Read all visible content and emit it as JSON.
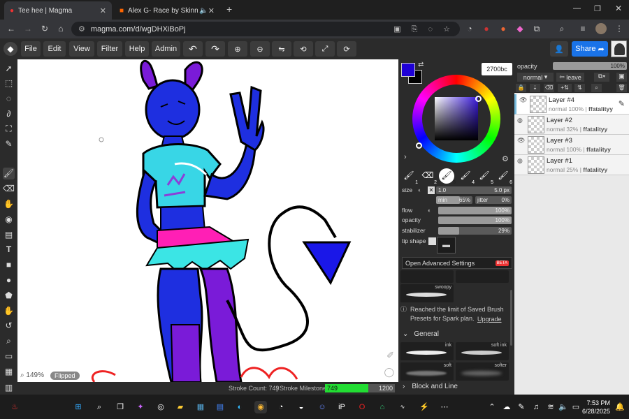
{
  "browser": {
    "tabs": [
      {
        "title": "Tee hee | Magma",
        "active": true
      },
      {
        "title": "Alex G- Race by SkinnyNSt",
        "active": false
      }
    ],
    "url": "magma.com/d/wgDHXiBoPj"
  },
  "menu": {
    "items": [
      "File",
      "Edit",
      "View",
      "Filter",
      "Help",
      "Admin"
    ],
    "share_label": "Share"
  },
  "canvas": {
    "zoom": "149%",
    "flipped_label": "Flipped"
  },
  "status": {
    "stroke_count": "Stroke Count: 749",
    "milestone_label": "Stroke Milestone:",
    "milestone_value": "749",
    "milestone_max": "1200",
    "milestone_progress": 0.62
  },
  "colors": {
    "primary": "#1e00d6",
    "secondary": "#000000",
    "hex_value": "2700bc",
    "accent_blue": "#1a73e8"
  },
  "brush": {
    "size_label": "size",
    "size_value": "1.0",
    "size_px": "5.0 px",
    "min_label": "min",
    "min_value": "65%",
    "jitter_label": "jitter",
    "jitter_value": "0%",
    "flow_label": "flow",
    "flow_value": "100%",
    "opacity_label": "opacity",
    "opacity_value": "100%",
    "stabilizer_label": "stabilizer",
    "stabilizer_value": "29%",
    "stabilizer_fill": 0.29,
    "tip_label": "tip shape",
    "advanced_label": "Open Advanced Settings",
    "beta_label": "BETA",
    "presets": [
      "1",
      "2",
      "3",
      "4",
      "5",
      "6"
    ],
    "limit_text": "Reached the limit of Saved Brush Presets for Spark plan.",
    "upgrade_label": "Upgrade",
    "general_label": "General",
    "brush_names": [
      "swoopy",
      "ink",
      "soft ink",
      "soft",
      "softer"
    ],
    "block_label": "Block and Line"
  },
  "layers_panel": {
    "opacity_label": "opacity",
    "opacity_value": "100%",
    "blend_mode": "normal",
    "leave_label": "leave",
    "layers": [
      {
        "name": "Layer #4",
        "meta": "normal 100%",
        "owner": "ffatalityy",
        "selected": true
      },
      {
        "name": "Layer #2",
        "meta": "normal 32%",
        "owner": "ffatalityy",
        "selected": false
      },
      {
        "name": "Layer #3",
        "meta": "normal 100%",
        "owner": "ffatalityy",
        "selected": false
      },
      {
        "name": "Layer #1",
        "meta": "normal 25%",
        "owner": "ffatalityy",
        "selected": false
      }
    ]
  },
  "taskbar": {
    "time": "7:53 PM",
    "date": "6/28/2025"
  }
}
